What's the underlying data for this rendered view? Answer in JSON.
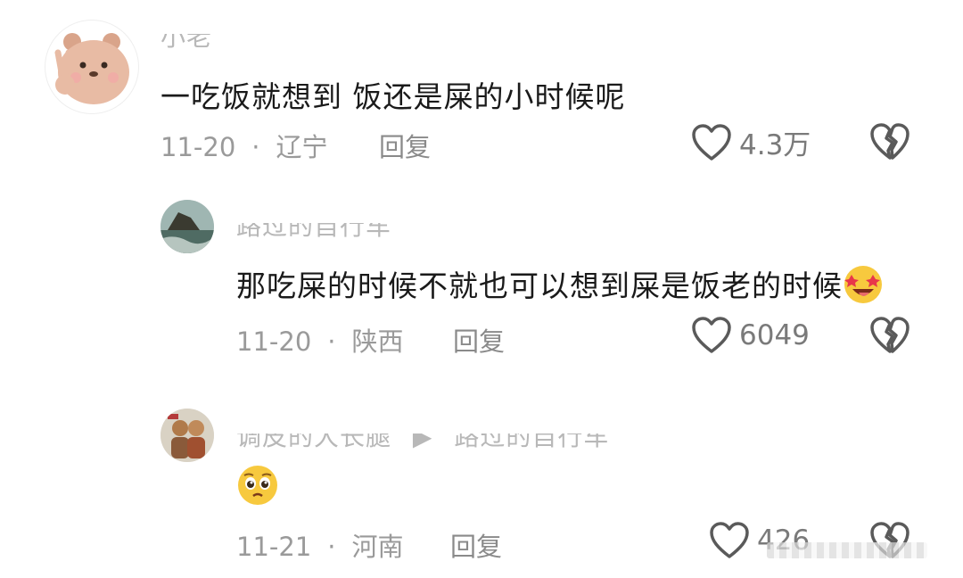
{
  "comments": [
    {
      "username": "小老",
      "text": "一吃饭就想到 饭还是屎的小时候呢",
      "date": "11-20",
      "location": "辽宁",
      "reply_label": "回复",
      "likes": "4.3万"
    },
    {
      "username": "路过的自行车",
      "text": "那吃屎的时候不就也可以想到屎是饭老的时候",
      "date": "11-20",
      "location": "陕西",
      "reply_label": "回复",
      "likes": "6049"
    },
    {
      "username": "调皮的大长腿",
      "reply_to": "路过的自行车",
      "date": "11-21",
      "location": "河南",
      "reply_label": "回复",
      "likes": "426"
    }
  ],
  "separator": "·",
  "icons": {
    "like": "heart-outline-icon",
    "dislike": "broken-heart-icon"
  },
  "colors": {
    "meta": "#9a9a9a",
    "text": "#1a1a1a",
    "icon": "#5a5a5a"
  }
}
